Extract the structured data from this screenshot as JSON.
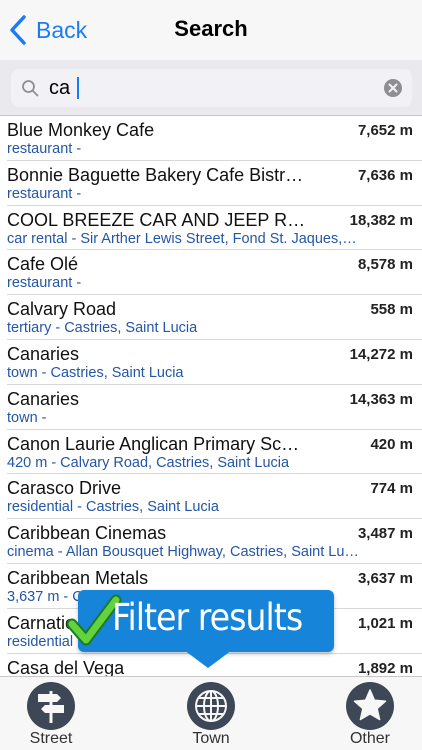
{
  "nav": {
    "back_label": "Back",
    "title": "Search"
  },
  "search": {
    "value": "ca",
    "placeholder": ""
  },
  "results": [
    {
      "title": "Blue Monkey Cafe",
      "subtitle": "restaurant -",
      "distance": "7,652 m"
    },
    {
      "title": "Bonnie Baguette Bakery Cafe Bistr…",
      "subtitle": "restaurant -",
      "distance": "7,636 m"
    },
    {
      "title": "COOL BREEZE CAR AND JEEP R…",
      "subtitle": "car rental - Sir Arther Lewis Street, Fond St. Jaques,…",
      "distance": "18,382 m"
    },
    {
      "title": "Cafe Olé",
      "subtitle": "restaurant -",
      "distance": "8,578 m"
    },
    {
      "title": "Calvary Road",
      "subtitle": "tertiary - Castries, Saint Lucia",
      "distance": "558 m"
    },
    {
      "title": "Canaries",
      "subtitle": "town - Castries, Saint Lucia",
      "distance": "14,272 m"
    },
    {
      "title": "Canaries",
      "subtitle": "town -",
      "distance": "14,363 m"
    },
    {
      "title": "Canon Laurie Anglican Primary Sc…",
      "subtitle": "420 m - Calvary Road, Castries, Saint Lucia",
      "distance": "420 m"
    },
    {
      "title": "Carasco Drive",
      "subtitle": "residential - Castries, Saint Lucia",
      "distance": "774 m"
    },
    {
      "title": "Caribbean Cinemas",
      "subtitle": "cinema - Allan Bousquet Highway, Castries, Saint Lu…",
      "distance": "3,487 m"
    },
    {
      "title": "Caribbean Metals",
      "subtitle": "3,637 m - Castries, Saint L…",
      "distance": "3,637 m"
    },
    {
      "title": "Carnatic",
      "subtitle": "residential",
      "distance": "1,021 m"
    },
    {
      "title": "Casa del Vega",
      "subtitle": "",
      "distance": "1,892 m"
    }
  ],
  "tooltip": {
    "text": "Filter results"
  },
  "tabs": [
    {
      "label": "Street",
      "icon": "signpost-icon"
    },
    {
      "label": "Town",
      "icon": "globe-icon"
    },
    {
      "label": "Other",
      "icon": "star-icon"
    }
  ],
  "colors": {
    "accent": "#1a7cf5",
    "link": "#2456a6",
    "tooltip": "#1684d8",
    "tab_icon": "#3d4756"
  }
}
